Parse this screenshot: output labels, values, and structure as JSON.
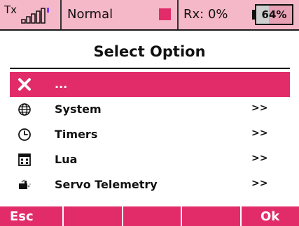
{
  "status": {
    "tx_label": "Tx",
    "mode": "Normal",
    "mode_color": "#e22c6a",
    "rx_text": "Rx:  0%",
    "battery_percent_text": "64%",
    "battery_level": 0.64,
    "signal_bars_lit": 0,
    "signal_bar_count": 5,
    "icons": [
      "signal-bars-icon",
      "battery-icon"
    ]
  },
  "title": "Select Option",
  "menu": {
    "items": [
      {
        "icon": "close-icon",
        "label": "...",
        "arrow": "",
        "selected": true
      },
      {
        "icon": "globe-icon",
        "label": "System",
        "arrow": ">>",
        "selected": false
      },
      {
        "icon": "clock-icon",
        "label": "Timers",
        "arrow": ">>",
        "selected": false
      },
      {
        "icon": "calendar-grid-icon",
        "label": "Lua",
        "arrow": ">>",
        "selected": false
      },
      {
        "icon": "servo-icon",
        "label": "Servo Telemetry",
        "arrow": ">>",
        "selected": false
      }
    ]
  },
  "softkeys": {
    "left": "Esc",
    "right": "Ok"
  },
  "colors": {
    "accent": "#e22c6a",
    "status_bg": "#f5b8c8"
  }
}
